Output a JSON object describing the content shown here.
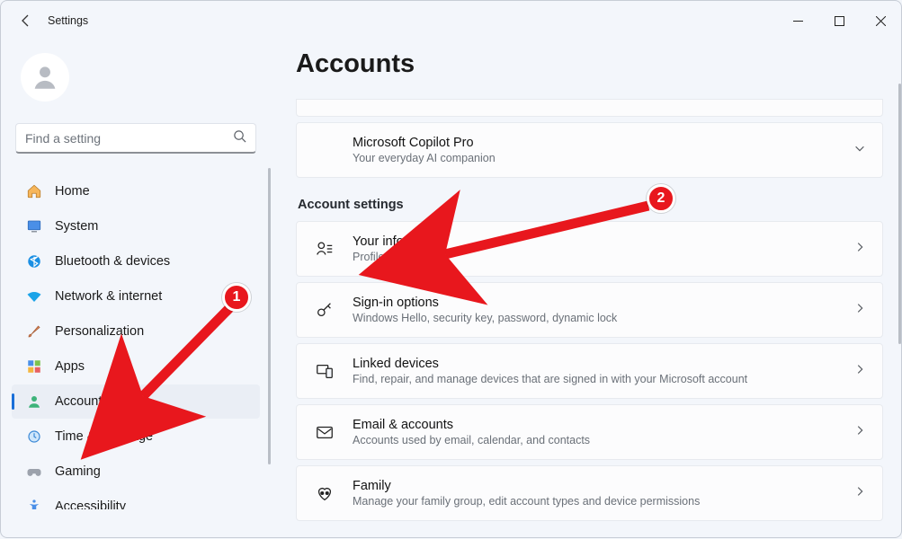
{
  "window": {
    "title": "Settings"
  },
  "search": {
    "placeholder": "Find a setting"
  },
  "sidebar": {
    "items": [
      {
        "label": "Home"
      },
      {
        "label": "System"
      },
      {
        "label": "Bluetooth & devices"
      },
      {
        "label": "Network & internet"
      },
      {
        "label": "Personalization"
      },
      {
        "label": "Apps"
      },
      {
        "label": "Accounts"
      },
      {
        "label": "Time & language"
      },
      {
        "label": "Gaming"
      },
      {
        "label": "Accessibility"
      }
    ],
    "active_index": 6
  },
  "main": {
    "heading": "Accounts",
    "promo": {
      "title": "Microsoft Copilot Pro",
      "sub": "Your everyday AI companion"
    },
    "section_heading": "Account settings",
    "cards": [
      {
        "title": "Your info",
        "sub": "Profile photo"
      },
      {
        "title": "Sign-in options",
        "sub": "Windows Hello, security key, password, dynamic lock"
      },
      {
        "title": "Linked devices",
        "sub": "Find, repair, and manage devices that are signed in with your Microsoft account"
      },
      {
        "title": "Email & accounts",
        "sub": "Accounts used by email, calendar, and contacts"
      },
      {
        "title": "Family",
        "sub": "Manage your family group, edit account types and device permissions"
      }
    ]
  },
  "annotations": {
    "callout1": "1",
    "callout2": "2"
  }
}
